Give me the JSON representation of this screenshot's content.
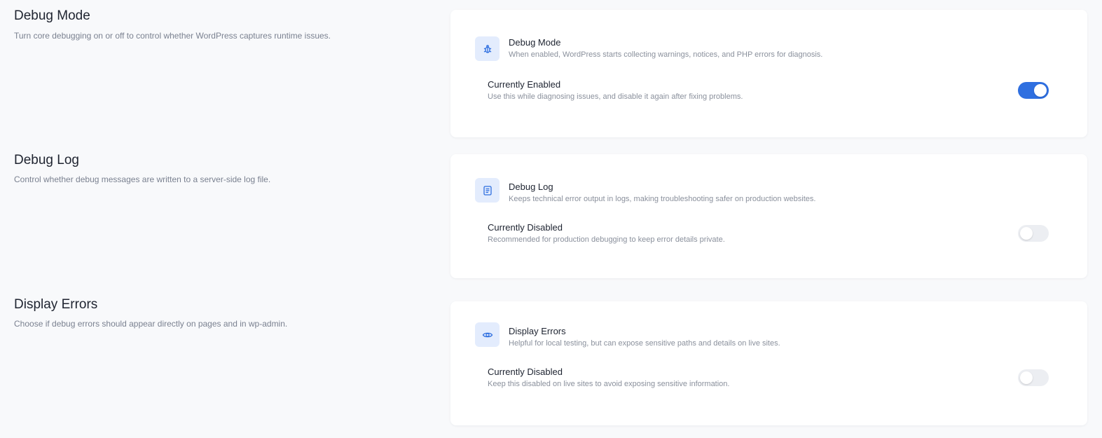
{
  "sections": [
    {
      "title": "Debug Mode",
      "description": "Turn core debugging on or off to control whether WordPress captures runtime issues.",
      "card": {
        "icon": "bug-icon",
        "title": "Debug Mode",
        "description": "When enabled, WordPress starts collecting warnings, notices, and PHP errors for diagnosis.",
        "status_title": "Currently Enabled",
        "status_description": "Use this while diagnosing issues, and disable it again after fixing problems.",
        "toggle_on": true
      }
    },
    {
      "title": "Debug Log",
      "description": "Control whether debug messages are written to a server-side log file.",
      "card": {
        "icon": "log-file-icon",
        "title": "Debug Log",
        "description": "Keeps technical error output in logs, making troubleshooting safer on production websites.",
        "status_title": "Currently Disabled",
        "status_description": "Recommended for production debugging to keep error details private.",
        "toggle_on": false
      }
    },
    {
      "title": "Display Errors",
      "description": "Choose if debug errors should appear directly on pages and in wp-admin.",
      "card": {
        "icon": "eye-icon",
        "title": "Display Errors",
        "description": "Helpful for local testing, but can expose sensitive paths and details on live sites.",
        "status_title": "Currently Disabled",
        "status_description": "Keep this disabled on live sites to avoid exposing sensitive information.",
        "toggle_on": false
      }
    }
  ],
  "colors": {
    "accent": "#2f6fe0",
    "icon_bg": "#e3ecfd",
    "page_bg": "#f8f9fb"
  }
}
